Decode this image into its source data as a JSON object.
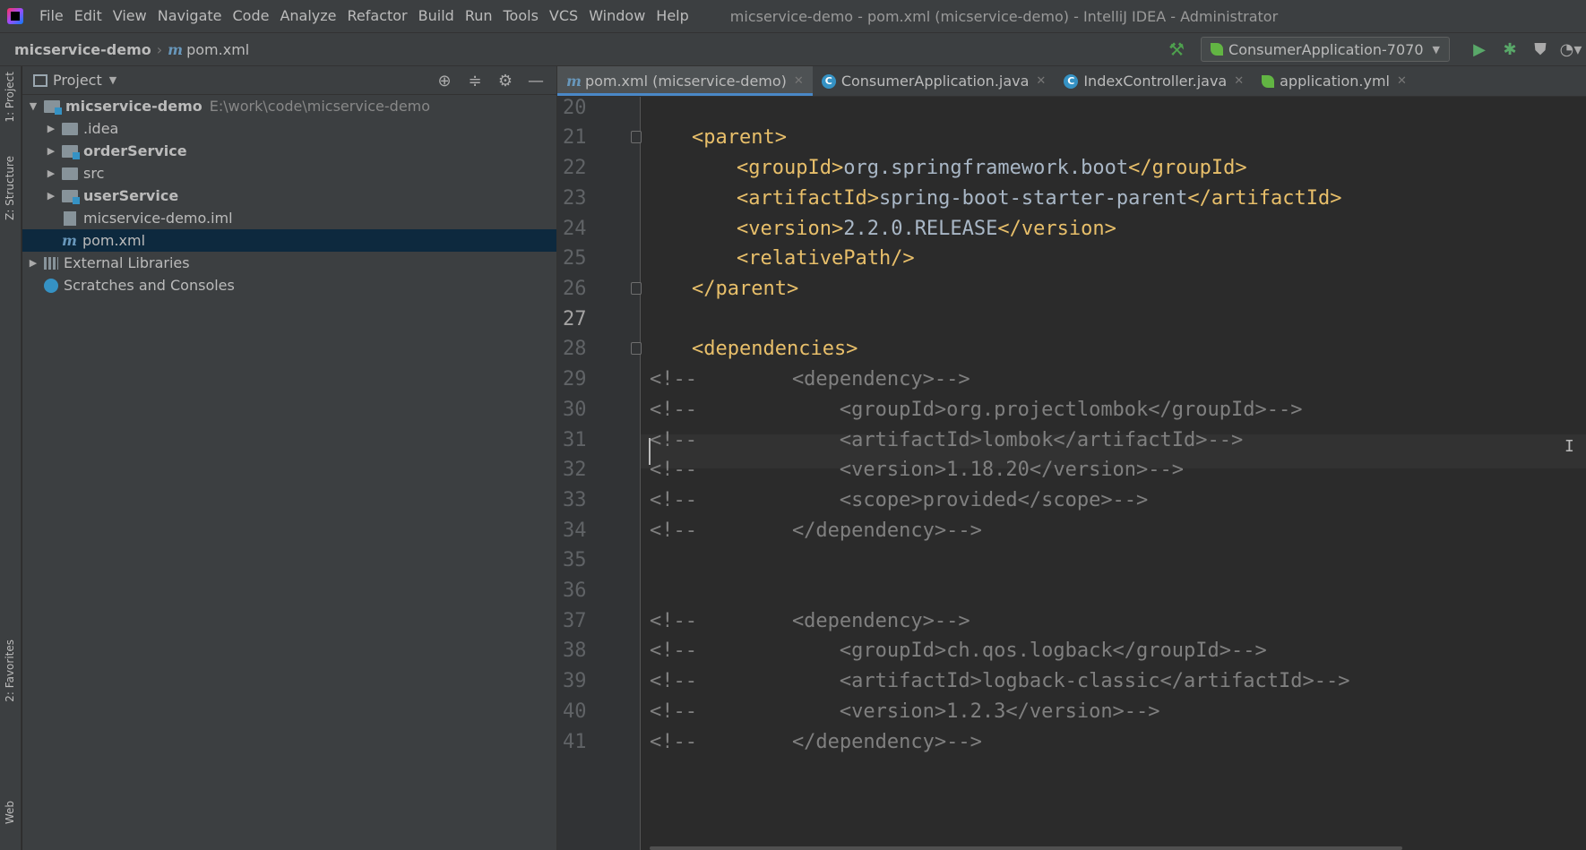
{
  "menu": {
    "items": [
      "File",
      "Edit",
      "View",
      "Navigate",
      "Code",
      "Analyze",
      "Refactor",
      "Build",
      "Run",
      "Tools",
      "VCS",
      "Window",
      "Help"
    ],
    "window_title": "micservice-demo - pom.xml (micservice-demo) - IntelliJ IDEA - Administrator"
  },
  "nav": {
    "project": "micservice-demo",
    "file_icon": "m",
    "file": "pom.xml",
    "run_config": "ConsumerApplication-7070"
  },
  "stripe": {
    "project": "1: Project",
    "structure": "Z: Structure",
    "favorites": "2: Favorites",
    "web": "Web"
  },
  "project_panel": {
    "title": "Project",
    "tree": [
      {
        "label": "micservice-demo",
        "path": "E:\\work\\code\\micservice-demo",
        "icon": "module-folder-icon",
        "expanded": true
      },
      {
        "label": ".idea",
        "icon": "folder-icon"
      },
      {
        "label": "orderService",
        "icon": "module-folder-icon"
      },
      {
        "label": "src",
        "icon": "folder-icon"
      },
      {
        "label": "userService",
        "icon": "module-folder-icon"
      },
      {
        "label": "micservice-demo.iml",
        "icon": "iml-file-icon"
      },
      {
        "label": "pom.xml",
        "icon": "maven-file-icon",
        "prefix": "m"
      },
      {
        "label": "External Libraries",
        "icon": "library-icon"
      },
      {
        "label": "Scratches and Consoles",
        "icon": "scratches-icon"
      }
    ]
  },
  "tabs": [
    {
      "icon": "m",
      "label": "pom.xml (micservice-demo)",
      "active": true
    },
    {
      "icon": "C",
      "label": "ConsumerApplication.java"
    },
    {
      "icon": "C",
      "label": "IndexController.java"
    },
    {
      "icon": "yml",
      "label": "application.yml"
    }
  ],
  "editor": {
    "line_numbers": [
      "20",
      "21",
      "22",
      "23",
      "24",
      "25",
      "26",
      "27",
      "28",
      "29",
      "30",
      "31",
      "32",
      "33",
      "34",
      "35",
      "36",
      "37",
      "38",
      "39",
      "40",
      "41"
    ],
    "current_line": "27",
    "lines": {
      "l21": "<parent>",
      "l22_tag1": "<groupId>",
      "l22_text": "org.springframework.boot",
      "l22_tag2": "</groupId>",
      "l23_tag1": "<artifactId>",
      "l23_text": "spring-boot-starter-parent",
      "l23_tag2": "</artifactId>",
      "l24_tag1": "<version>",
      "l24_text": "2.2.0.RELEASE",
      "l24_tag2": "</version>",
      "l25": "<relativePath/>",
      "l26": "</parent>",
      "l28": "<dependencies>",
      "l29": "<!--        <dependency>-->",
      "l30": "<!--            <groupId>org.projectlombok</groupId>-->",
      "l31": "<!--            <artifactId>lombok</artifactId>-->",
      "l32": "<!--            <version>1.18.20</version>-->",
      "l33": "<!--            <scope>provided</scope>-->",
      "l34": "<!--        </dependency>-->",
      "l37": "<!--        <dependency>-->",
      "l38": "<!--            <groupId>ch.qos.logback</groupId>-->",
      "l39": "<!--            <artifactId>logback-classic</artifactId>-->",
      "l40": "<!--            <version>1.2.3</version>-->",
      "l41": "<!--        </dependency>-->"
    }
  }
}
